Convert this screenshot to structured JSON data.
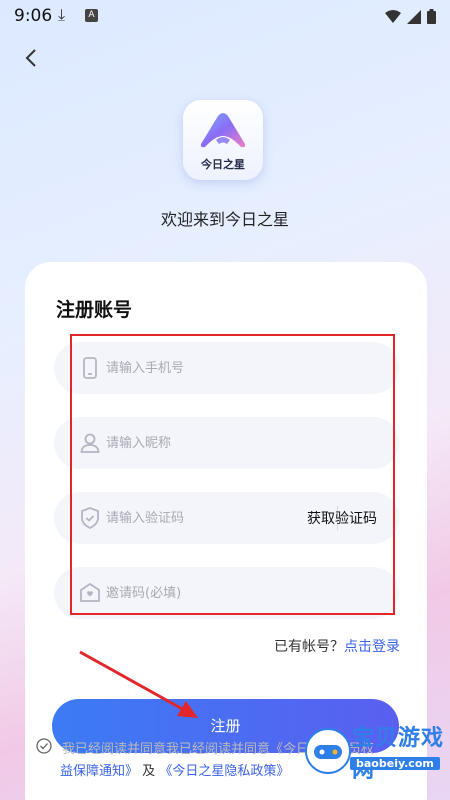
{
  "status_bar": {
    "time": "9:06"
  },
  "app": {
    "logo_name": "今日之星",
    "welcome": "欢迎来到今日之星"
  },
  "form": {
    "title": "注册账号",
    "phone_placeholder": "请输入手机号",
    "nickname_placeholder": "请输入昵称",
    "code_placeholder": "请输入验证码",
    "get_code_label": "获取验证码",
    "invite_placeholder": "邀请码(必填)"
  },
  "login": {
    "question": "已有帐号？",
    "link": "点击登录"
  },
  "register_button": "注册",
  "agreement": {
    "line1": "我已经阅读并同意我已经阅读并同意《今日之星会员权",
    "link1": "益保障通知》",
    "and": "及",
    "link2": "《今日之星隐私政策》"
  },
  "watermark": {
    "text": "宝贝游戏网",
    "url": "baobeiy.com"
  },
  "colors": {
    "accent": "#3a62e6",
    "button_start": "#3c7bf4",
    "button_end": "#5a5ff0",
    "highlight": "#e2262a"
  }
}
